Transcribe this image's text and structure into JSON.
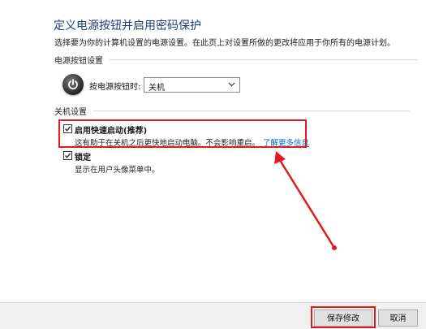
{
  "header": {
    "title": "定义电源按钮并启用密码保护",
    "description": "选择要为你的计算机设置的电源设置。在此页上对设置所做的更改将应用于你所有的电源计划。"
  },
  "power_button_section": {
    "header": "电源按钮设置",
    "icon": "power-button-icon",
    "label": "按电源按钮时:",
    "selected": "关机"
  },
  "shutdown_section": {
    "header": "关机设置",
    "items": [
      {
        "label": "启用快速启动(推荐)",
        "checked": true,
        "description": "这有助于在关机之后更快地启动电脑。不会影响重启。",
        "link": "了解更多信息"
      },
      {
        "label": "锁定",
        "checked": true,
        "description": "显示在用户头像菜单中。"
      }
    ]
  },
  "footer": {
    "save_label": "保存修改",
    "cancel_label": "取消"
  },
  "annotation": {
    "color": "#e01b1b"
  }
}
